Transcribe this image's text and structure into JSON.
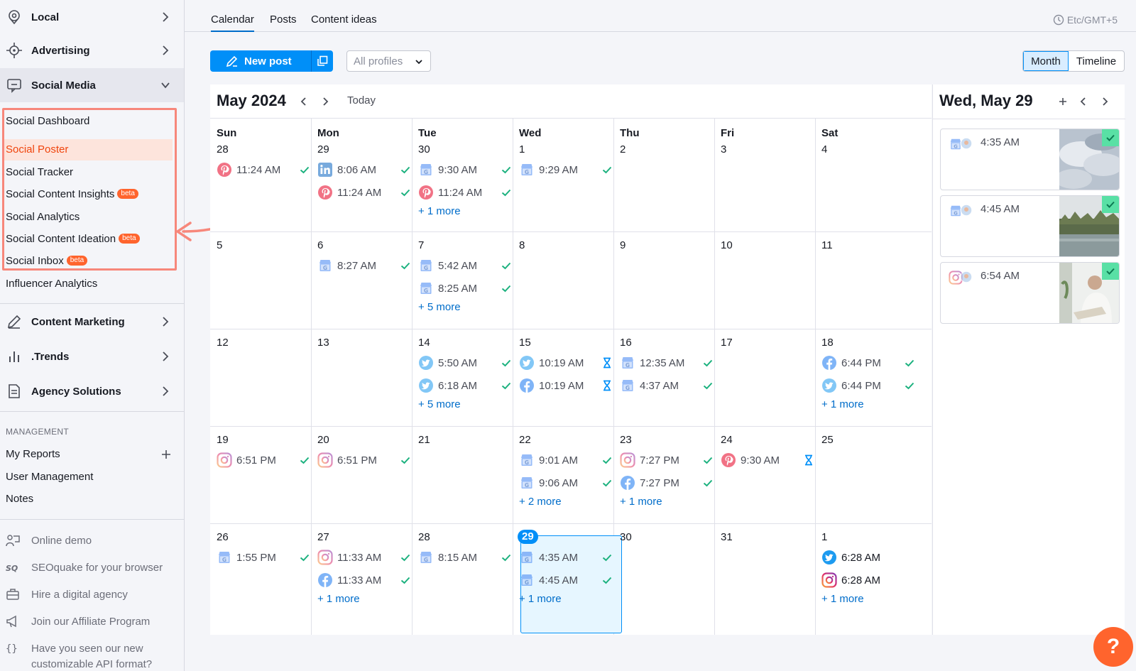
{
  "sidebar": {
    "nav": [
      {
        "label": "Local",
        "icon": "location-pin-icon"
      },
      {
        "label": "Advertising",
        "icon": "crosshair-icon"
      },
      {
        "label": "Social Media",
        "icon": "social-media-icon"
      }
    ],
    "social_items": [
      {
        "label": "Social Dashboard"
      },
      {
        "label": "Social Poster"
      },
      {
        "label": "Social Tracker"
      },
      {
        "label": "Social Content Insights",
        "badge": "beta"
      },
      {
        "label": "Social Analytics"
      },
      {
        "label": "Social Content Ideation",
        "badge": "beta"
      },
      {
        "label": "Social Inbox",
        "badge": "beta"
      },
      {
        "label": "Influencer Analytics"
      }
    ],
    "nav2": [
      {
        "label": "Content Marketing",
        "icon": "pencil-icon"
      },
      {
        "label": ".Trends",
        "icon": "bar-chart-icon"
      },
      {
        "label": "Agency Solutions",
        "icon": "document-icon"
      }
    ],
    "management": {
      "title": "MANAGEMENT",
      "items": [
        {
          "label": "My Reports"
        },
        {
          "label": "User Management"
        },
        {
          "label": "Notes"
        }
      ]
    },
    "footer": [
      {
        "label": "Online demo",
        "icon": "presenter-icon"
      },
      {
        "label": "SEOquake for your browser",
        "icon": "seoquake-icon"
      },
      {
        "label": "Hire a digital agency",
        "icon": "briefcase-icon"
      },
      {
        "label": "Join our Affiliate Program",
        "icon": "megaphone-icon"
      },
      {
        "label": "Have you seen our new customizable API format?",
        "icon": "braces-icon"
      }
    ]
  },
  "tabs": [
    {
      "label": "Calendar"
    },
    {
      "label": "Posts"
    },
    {
      "label": "Content ideas"
    }
  ],
  "timezone": "Etc/GMT+5",
  "toolbar": {
    "new_post": "New post",
    "profiles": "All profiles",
    "view_month": "Month",
    "view_timeline": "Timeline"
  },
  "calendar": {
    "title": "May 2024",
    "today": "Today",
    "days_of_week": [
      "Sun",
      "Mon",
      "Tue",
      "Wed",
      "Thu",
      "Fri",
      "Sat"
    ],
    "weeks": [
      [
        {
          "day": "28",
          "posts": [
            {
              "net": "pinterest",
              "time": "11:24 AM",
              "status": "published"
            }
          ]
        },
        {
          "day": "29",
          "posts": [
            {
              "net": "linkedin",
              "time": "8:06 AM",
              "status": "published"
            },
            {
              "net": "pinterest",
              "time": "11:24 AM",
              "status": "published"
            }
          ]
        },
        {
          "day": "30",
          "posts": [
            {
              "net": "gbp",
              "time": "9:30 AM",
              "status": "published"
            },
            {
              "net": "pinterest",
              "time": "11:24 AM",
              "status": "published"
            }
          ],
          "more": "+ 1 more"
        },
        {
          "day": "1",
          "posts": [
            {
              "net": "gbp",
              "time": "9:29 AM",
              "status": "published"
            }
          ]
        },
        {
          "day": "2",
          "posts": []
        },
        {
          "day": "3",
          "posts": []
        },
        {
          "day": "4",
          "posts": []
        }
      ],
      [
        {
          "day": "5",
          "posts": []
        },
        {
          "day": "6",
          "posts": [
            {
              "net": "gbp",
              "time": "8:27 AM",
              "status": "published"
            }
          ]
        },
        {
          "day": "7",
          "posts": [
            {
              "net": "gbp",
              "time": "5:42 AM",
              "status": "published"
            },
            {
              "net": "gbp",
              "time": "8:25 AM",
              "status": "published"
            }
          ],
          "more": "+ 5 more"
        },
        {
          "day": "8",
          "posts": []
        },
        {
          "day": "9",
          "posts": []
        },
        {
          "day": "10",
          "posts": []
        },
        {
          "day": "11",
          "posts": []
        }
      ],
      [
        {
          "day": "12",
          "posts": []
        },
        {
          "day": "13",
          "posts": []
        },
        {
          "day": "14",
          "posts": [
            {
              "net": "twitter",
              "time": "5:50 AM",
              "status": "published"
            },
            {
              "net": "twitter",
              "time": "6:18 AM",
              "status": "published"
            }
          ],
          "more": "+ 5 more"
        },
        {
          "day": "15",
          "posts": [
            {
              "net": "twitter",
              "time": "10:19 AM",
              "status": "pending"
            },
            {
              "net": "facebook",
              "time": "10:19 AM",
              "status": "pending"
            }
          ]
        },
        {
          "day": "16",
          "posts": [
            {
              "net": "gbp",
              "time": "12:35 AM",
              "status": "published"
            },
            {
              "net": "gbp",
              "time": "4:37 AM",
              "status": "published"
            }
          ]
        },
        {
          "day": "17",
          "posts": []
        },
        {
          "day": "18",
          "posts": [
            {
              "net": "facebook",
              "time": "6:44 PM",
              "status": "published"
            },
            {
              "net": "twitter",
              "time": "6:44 PM",
              "status": "published"
            }
          ],
          "more": "+ 1 more"
        }
      ],
      [
        {
          "day": "19",
          "posts": [
            {
              "net": "instagram",
              "time": "6:51 PM",
              "status": "published"
            }
          ]
        },
        {
          "day": "20",
          "posts": [
            {
              "net": "instagram",
              "time": "6:51 PM",
              "status": "published"
            }
          ]
        },
        {
          "day": "21",
          "posts": []
        },
        {
          "day": "22",
          "posts": [
            {
              "net": "gbp",
              "time": "9:01 AM",
              "status": "published"
            },
            {
              "net": "gbp",
              "time": "9:06 AM",
              "status": "published"
            }
          ],
          "more": "+ 2 more"
        },
        {
          "day": "23",
          "posts": [
            {
              "net": "instagram",
              "time": "7:27 PM",
              "status": "published"
            },
            {
              "net": "facebook",
              "time": "7:27 PM",
              "status": "published"
            }
          ],
          "more": "+ 1 more"
        },
        {
          "day": "24",
          "posts": [
            {
              "net": "pinterest",
              "time": "9:30 AM",
              "status": "pending"
            }
          ]
        },
        {
          "day": "25",
          "posts": []
        }
      ],
      [
        {
          "day": "26",
          "posts": [
            {
              "net": "gbp",
              "time": "1:55 PM",
              "status": "published"
            }
          ]
        },
        {
          "day": "27",
          "posts": [
            {
              "net": "instagram",
              "time": "11:33 AM",
              "status": "published"
            },
            {
              "net": "facebook",
              "time": "11:33 AM",
              "status": "published"
            }
          ],
          "more": "+ 1 more"
        },
        {
          "day": "28",
          "posts": [
            {
              "net": "gbp",
              "time": "8:15 AM",
              "status": "published"
            }
          ]
        },
        {
          "day": "29",
          "today": true,
          "posts": [
            {
              "net": "gbp",
              "time": "4:35 AM",
              "status": "published"
            },
            {
              "net": "gbp",
              "time": "4:45 AM",
              "status": "published"
            }
          ],
          "more": "+ 1 more"
        },
        {
          "day": "30",
          "posts": []
        },
        {
          "day": "31",
          "posts": []
        },
        {
          "day": "1",
          "posts": [
            {
              "net": "twitter",
              "time": "6:28 AM",
              "status": "scheduled"
            },
            {
              "net": "instagram",
              "time": "6:28 AM",
              "status": "scheduled"
            }
          ],
          "more": "+ 1 more"
        }
      ]
    ]
  },
  "day_panel": {
    "title": "Wed, May 29",
    "cards": [
      {
        "net": "gbp",
        "time": "4:35 AM",
        "thumb": "clouds"
      },
      {
        "net": "gbp",
        "time": "4:45 AM",
        "thumb": "lake"
      },
      {
        "net": "instagram",
        "time": "6:54 AM",
        "thumb": "person"
      }
    ]
  },
  "help_label": "?",
  "colors": {
    "accent": "#008ff8",
    "brand_orange": "#ff642d",
    "success": "#1bb17e",
    "link": "#006dca",
    "highlight": "#f7877b"
  }
}
